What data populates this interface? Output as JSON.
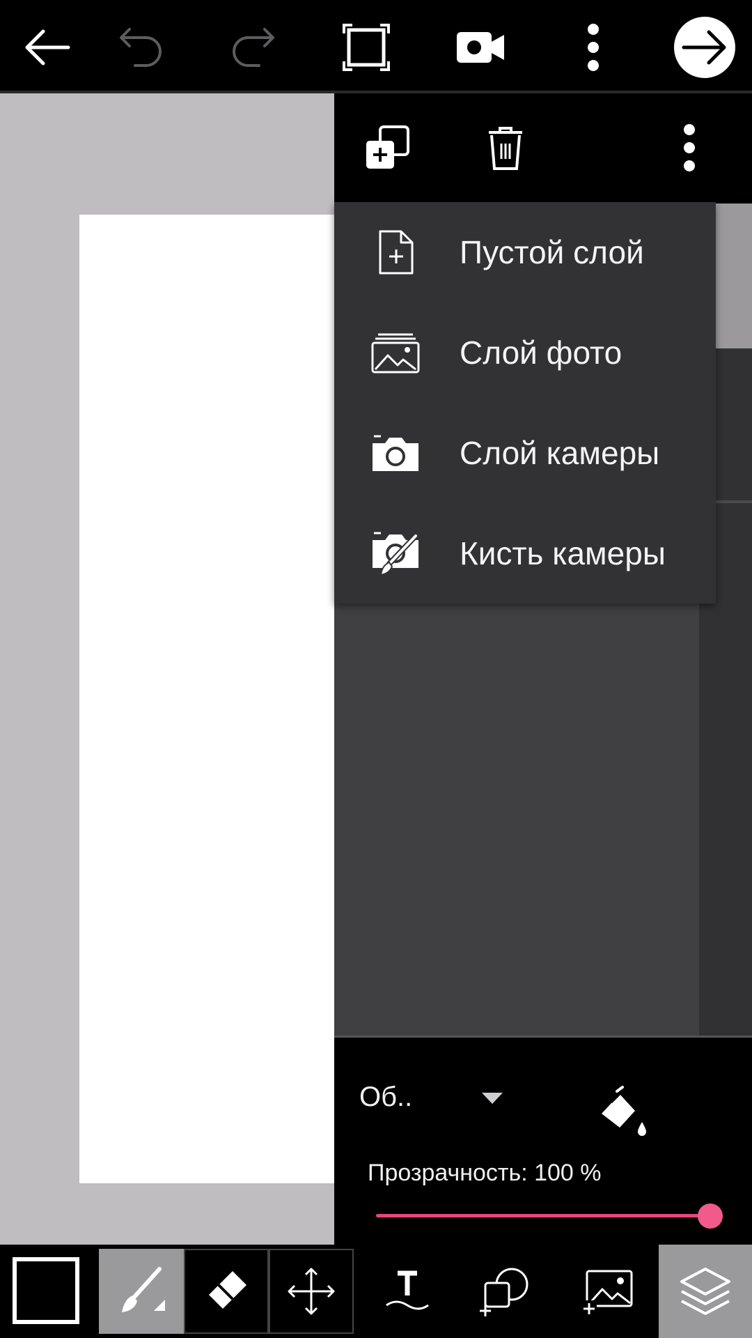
{
  "top_toolbar": {
    "icons": [
      "back-arrow-icon",
      "undo-icon",
      "redo-icon",
      "fullscreen-icon",
      "video-camera-icon",
      "more-vert-icon",
      "next-arrow-icon"
    ]
  },
  "layers_toolbar": {
    "icons": [
      "add-layer-icon",
      "trash-icon",
      "more-vert-icon"
    ]
  },
  "add_layer_menu": {
    "items": [
      {
        "label": "Пустой слой",
        "icon": "new-file-icon"
      },
      {
        "label": "Слой фото",
        "icon": "photo-icon"
      },
      {
        "label": "Слой камеры",
        "icon": "camera-icon"
      },
      {
        "label": "Кисть камеры",
        "icon": "camera-brush-icon"
      }
    ]
  },
  "blend": {
    "mode_label": "Об..",
    "opacity_label": "Прозрачность: 100 %",
    "opacity_value": 100
  },
  "bottom_toolbar": {
    "tools": [
      "color-swatch",
      "brush-icon",
      "eraser-icon",
      "move-icon",
      "text-icon",
      "shape-icon",
      "add-photo-icon",
      "layers-icon"
    ],
    "active_tool": "brush",
    "active_panel": "layers"
  },
  "colors": {
    "accent": "#f15b8c",
    "canvas_bg": "#bfbdc0",
    "panel_bg": "#313033"
  }
}
